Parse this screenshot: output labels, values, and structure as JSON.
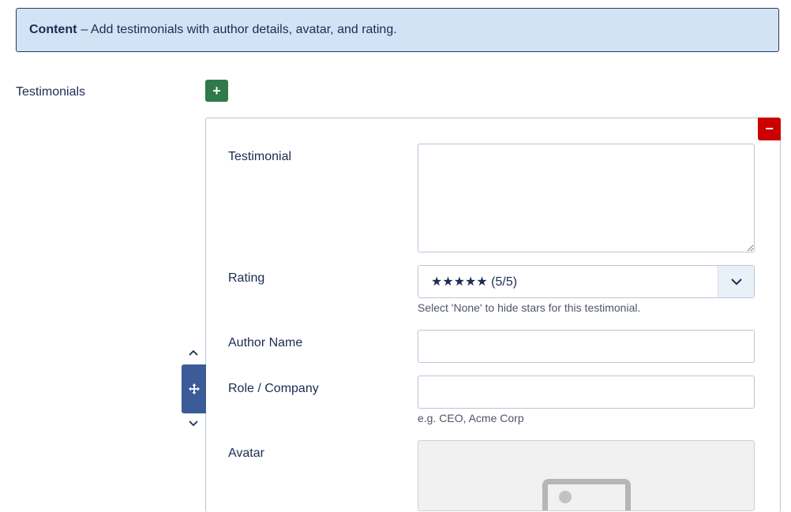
{
  "alert": {
    "title": "Content",
    "message": "– Add testimonials with author details, avatar, and rating."
  },
  "testimonials": {
    "label": "Testimonials",
    "add_label": "+",
    "remove_label": "−"
  },
  "item": {
    "testimonial_label": "Testimonial",
    "testimonial_value": "",
    "rating_label": "Rating",
    "rating_value": "★★★★★ (5/5)",
    "rating_hint": "Select 'None' to hide stars for this testimonial.",
    "author_label": "Author Name",
    "author_value": "",
    "role_label": "Role / Company",
    "role_value": "",
    "role_hint": "e.g. CEO, Acme Corp",
    "avatar_label": "Avatar"
  },
  "colors": {
    "add": "#2e7a4a",
    "remove": "#cc0000",
    "drag": "#3b5b99",
    "alert_bg": "#d3e3f6"
  },
  "icons": {
    "add": "plus-icon",
    "remove": "minus-icon",
    "drag": "move-icon",
    "up": "chevron-up-icon",
    "down": "chevron-down-icon",
    "select": "chevron-down-icon",
    "avatar": "image-placeholder-icon"
  }
}
